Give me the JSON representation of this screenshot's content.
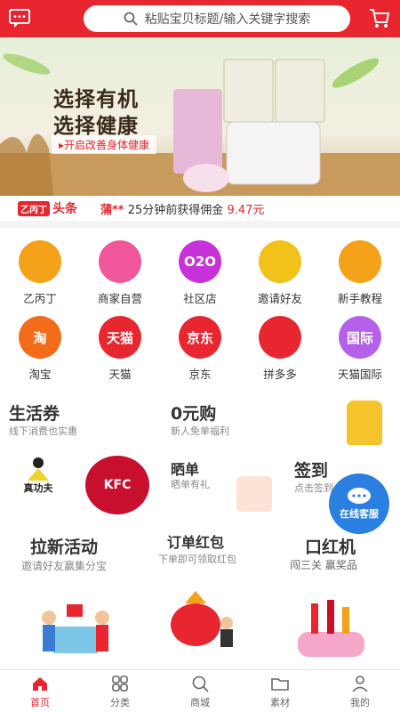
{
  "search": {
    "placeholder": "粘贴宝贝标题/输入关键字搜索"
  },
  "banner": {
    "line1": "选择有机",
    "line2": "选择健康",
    "cta": "▸开启改善身体健康"
  },
  "news": {
    "logo_badge": "乙丙丁",
    "logo_text": "头条",
    "who": "蒲**",
    "text": "25分钟前获得佣金",
    "amount": "9.47元"
  },
  "grid": [
    [
      {
        "label": "乙丙丁",
        "color": "#f3a21a"
      },
      {
        "label": "商家自营",
        "color": "#f0569a"
      },
      {
        "label": "社区店",
        "color": "#c733d8"
      },
      {
        "label": "邀请好友",
        "color": "#f3c21a"
      },
      {
        "label": "新手教程",
        "color": "#f3a21a"
      }
    ],
    [
      {
        "label": "淘宝",
        "color": "#f36c1a"
      },
      {
        "label": "天猫",
        "color": "#e8262f"
      },
      {
        "label": "京东",
        "color": "#e8262f"
      },
      {
        "label": "拼多多",
        "color": "#e8262f"
      },
      {
        "label": "天猫国际",
        "color": "#b560e8"
      }
    ]
  ],
  "grid_icon_text": [
    "",
    "",
    "O2O",
    "",
    "",
    "淘",
    "天猫",
    "京东",
    "",
    "国际"
  ],
  "sections": {
    "life_title": "生活券",
    "life_sub": "线下消费也实惠",
    "zero_title": "0元购",
    "zero_sub": "新人免单福利",
    "show_title": "晒单",
    "show_sub": "晒单有礼",
    "sign_title": "签到",
    "sign_sub": "点击签到",
    "invite_title": "拉新活动",
    "invite_sub": "邀请好友赢集分宝",
    "order_title": "订单红包",
    "order_sub": "下单即可领取红包",
    "lip_title": "口红机",
    "lip_sub": "闯三关 赢奖品",
    "kfc": "KFC",
    "zgf": "真功夫"
  },
  "fab": {
    "label": "在线客服"
  },
  "tabbar": [
    {
      "label": "首页",
      "icon": "home-icon",
      "active": true
    },
    {
      "label": "分类",
      "icon": "grid-icon"
    },
    {
      "label": "商城",
      "icon": "search-icon"
    },
    {
      "label": "素材",
      "icon": "folder-icon"
    },
    {
      "label": "我的",
      "icon": "user-icon"
    }
  ],
  "colors": {
    "accent": "#e8262f",
    "fab": "#2a7fe0"
  }
}
